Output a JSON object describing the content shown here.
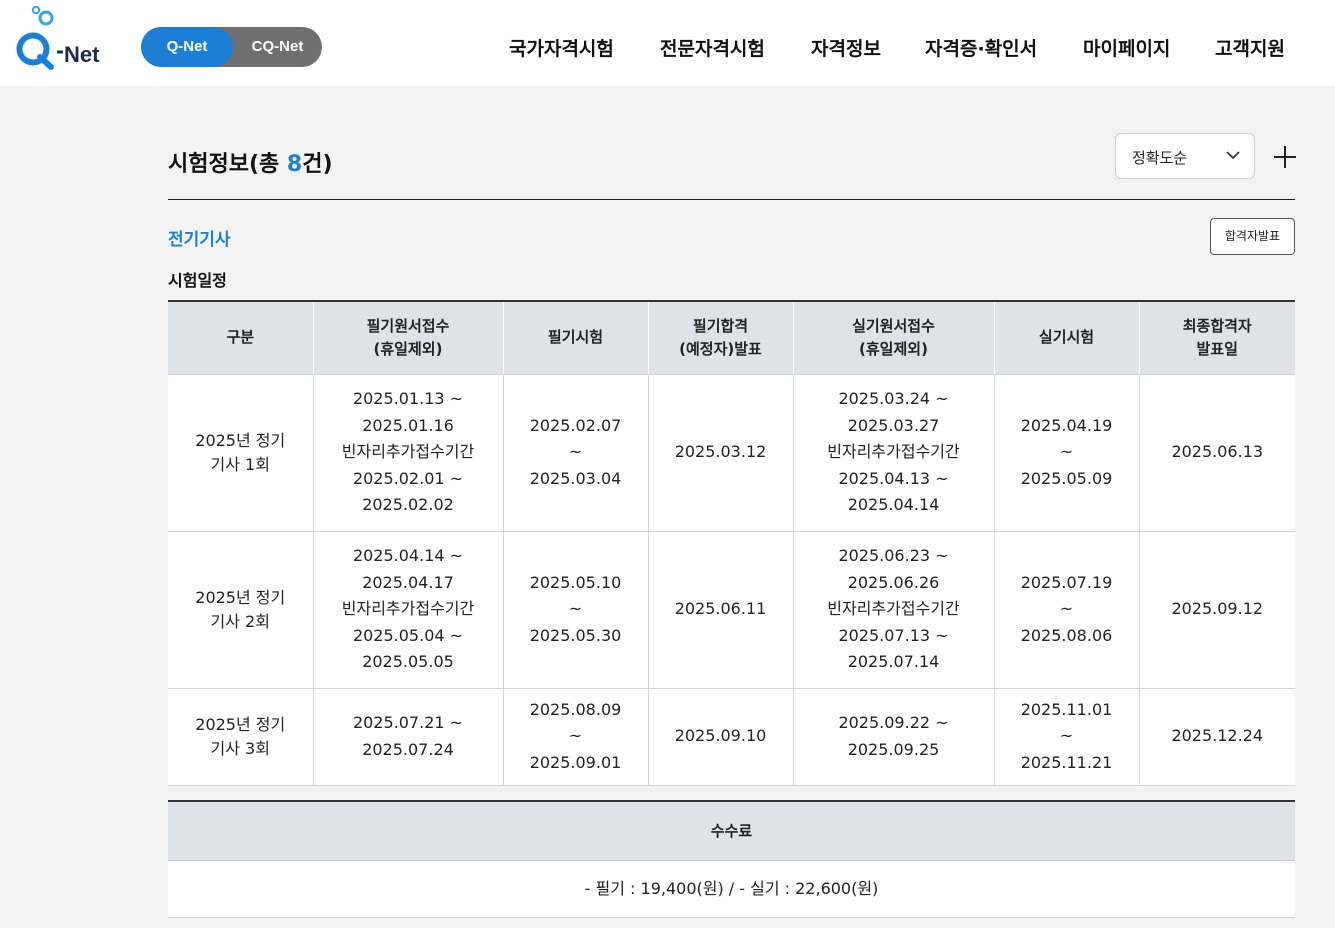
{
  "brand": {
    "logo_text": "Q-Net",
    "toggle_active": "Q-Net",
    "toggle_inactive": "CQ-Net",
    "accent": "#1b7fd6"
  },
  "nav": [
    "국가자격시험",
    "전문자격시험",
    "자격정보",
    "자격증·확인서",
    "마이페이지",
    "고객지원"
  ],
  "results": {
    "title_prefix": "시험정보(총 ",
    "count": "8",
    "title_suffix": "건)",
    "sort_value": "정확도순"
  },
  "item": {
    "name": "전기기사",
    "result_button": "합격자발표",
    "schedule_title": "시험일정"
  },
  "schedule": {
    "headers": [
      "구분",
      "필기원서접수\n(휴일제외)",
      "필기시험",
      "필기합격\n(예정자)발표",
      "실기원서접수\n(휴일제외)",
      "실기시험",
      "최종합격자\n발표일"
    ],
    "rows": [
      [
        "2025년 정기\n기사 1회",
        "2025.01.13 ~\n2025.01.16\n빈자리추가접수기간\n2025.02.01 ~\n2025.02.02",
        "2025.02.07\n~\n2025.03.04",
        "2025.03.12",
        "2025.03.24 ~\n2025.03.27\n빈자리추가접수기간\n2025.04.13 ~\n2025.04.14",
        "2025.04.19\n~\n2025.05.09",
        "2025.06.13"
      ],
      [
        "2025년 정기\n기사 2회",
        "2025.04.14 ~\n2025.04.17\n빈자리추가접수기간\n2025.05.04 ~\n2025.05.05",
        "2025.05.10\n~\n2025.05.30",
        "2025.06.11",
        "2025.06.23 ~\n2025.06.26\n빈자리추가접수기간\n2025.07.13 ~\n2025.07.14",
        "2025.07.19\n~\n2025.08.06",
        "2025.09.12"
      ],
      [
        "2025년 정기\n기사 3회",
        "2025.07.21 ~\n2025.07.24",
        "2025.08.09\n~\n2025.09.01",
        "2025.09.10",
        "2025.09.22 ~\n2025.09.25",
        "2025.11.01\n~\n2025.11.21",
        "2025.12.24"
      ]
    ]
  },
  "fee": {
    "header": "수수료",
    "value": "- 필기 : 19,400(원) / - 실기 : 22,600(원)"
  }
}
